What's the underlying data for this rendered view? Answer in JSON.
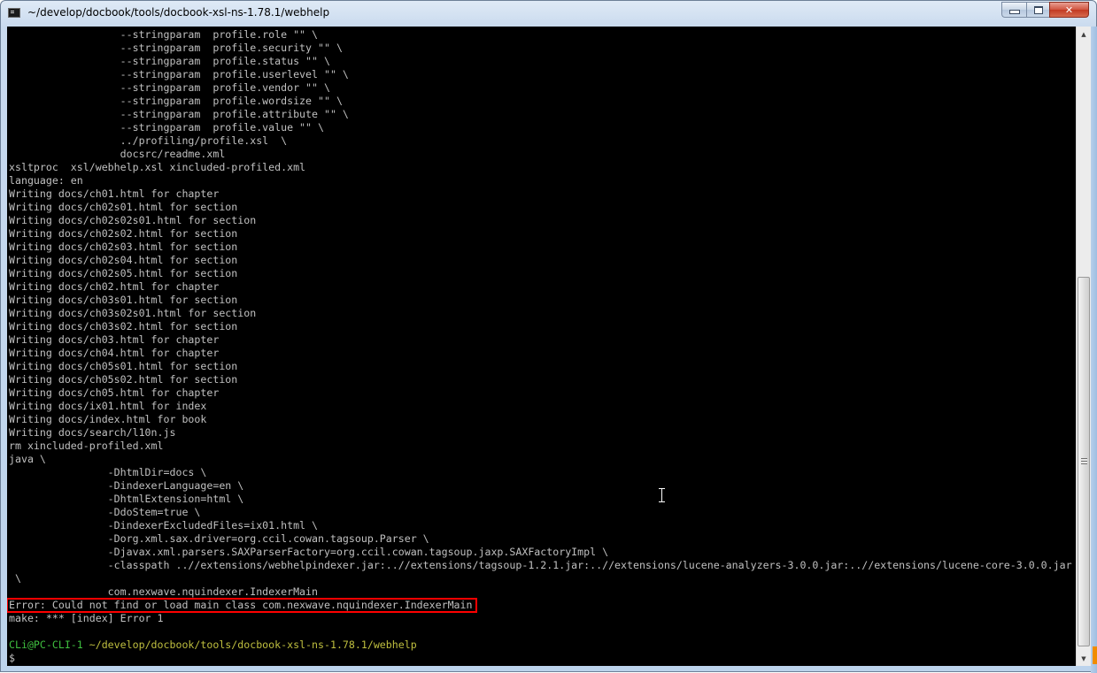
{
  "window": {
    "title": "~/develop/docbook/tools/docbook-xsl-ns-1.78.1/webhelp",
    "controls": {
      "minimize_label": "Minimize",
      "maximize_label": "Maximize",
      "close_label": "Close",
      "close_glyph": "✕"
    }
  },
  "terminal": {
    "lines": [
      "                  --stringparam  profile.role \"\" \\",
      "                  --stringparam  profile.security \"\" \\",
      "                  --stringparam  profile.status \"\" \\",
      "                  --stringparam  profile.userlevel \"\" \\",
      "                  --stringparam  profile.vendor \"\" \\",
      "                  --stringparam  profile.wordsize \"\" \\",
      "                  --stringparam  profile.attribute \"\" \\",
      "                  --stringparam  profile.value \"\" \\",
      "                  ../profiling/profile.xsl  \\",
      "                  docsrc/readme.xml",
      "xsltproc  xsl/webhelp.xsl xincluded-profiled.xml",
      "language: en",
      "Writing docs/ch01.html for chapter",
      "Writing docs/ch02s01.html for section",
      "Writing docs/ch02s02s01.html for section",
      "Writing docs/ch02s02.html for section",
      "Writing docs/ch02s03.html for section",
      "Writing docs/ch02s04.html for section",
      "Writing docs/ch02s05.html for section",
      "Writing docs/ch02.html for chapter",
      "Writing docs/ch03s01.html for section",
      "Writing docs/ch03s02s01.html for section",
      "Writing docs/ch03s02.html for section",
      "Writing docs/ch03.html for chapter",
      "Writing docs/ch04.html for chapter",
      "Writing docs/ch05s01.html for section",
      "Writing docs/ch05s02.html for section",
      "Writing docs/ch05.html for chapter",
      "Writing docs/ix01.html for index",
      "Writing docs/index.html for book",
      "Writing docs/search/l10n.js",
      "rm xincluded-profiled.xml",
      "java \\",
      "                -DhtmlDir=docs \\",
      "                -DindexerLanguage=en \\",
      "                -DhtmlExtension=html \\",
      "                -DdoStem=true \\",
      "                -DindexerExcludedFiles=ix01.html \\",
      "                -Dorg.xml.sax.driver=org.ccil.cowan.tagsoup.Parser \\",
      "                -Djavax.xml.parsers.SAXParserFactory=org.ccil.cowan.tagsoup.jaxp.SAXFactoryImpl \\",
      "                -classpath ..//extensions/webhelpindexer.jar:..//extensions/tagsoup-1.2.1.jar:..//extensions/lucene-analyzers-3.0.0.jar:..//extensions/lucene-core-3.0.0.jar",
      " \\",
      "                com.nexwave.nquindexer.IndexerMain",
      "Error: Could not find or load main class com.nexwave.nquindexer.IndexerMain",
      "make: *** [index] Error 1",
      ""
    ],
    "prompt": {
      "user_host": "CLi@PC-CLI-1",
      "path": " ~/develop/docbook/tools/docbook-xsl-ns-1.78.1/webhelp",
      "symbol": "$"
    },
    "highlighted_line": "Error: Could not find or load main class com.nexwave.nquindexer.IndexerMain",
    "colors": {
      "background": "#000000",
      "text": "#c0c0c0",
      "prompt_user": "#3fbf3f",
      "prompt_path": "#bfbf3f",
      "highlight_border": "#ff0000"
    }
  },
  "scrollbar": {
    "up_glyph": "▲",
    "down_glyph": "▼",
    "position_fraction": 0.42
  }
}
